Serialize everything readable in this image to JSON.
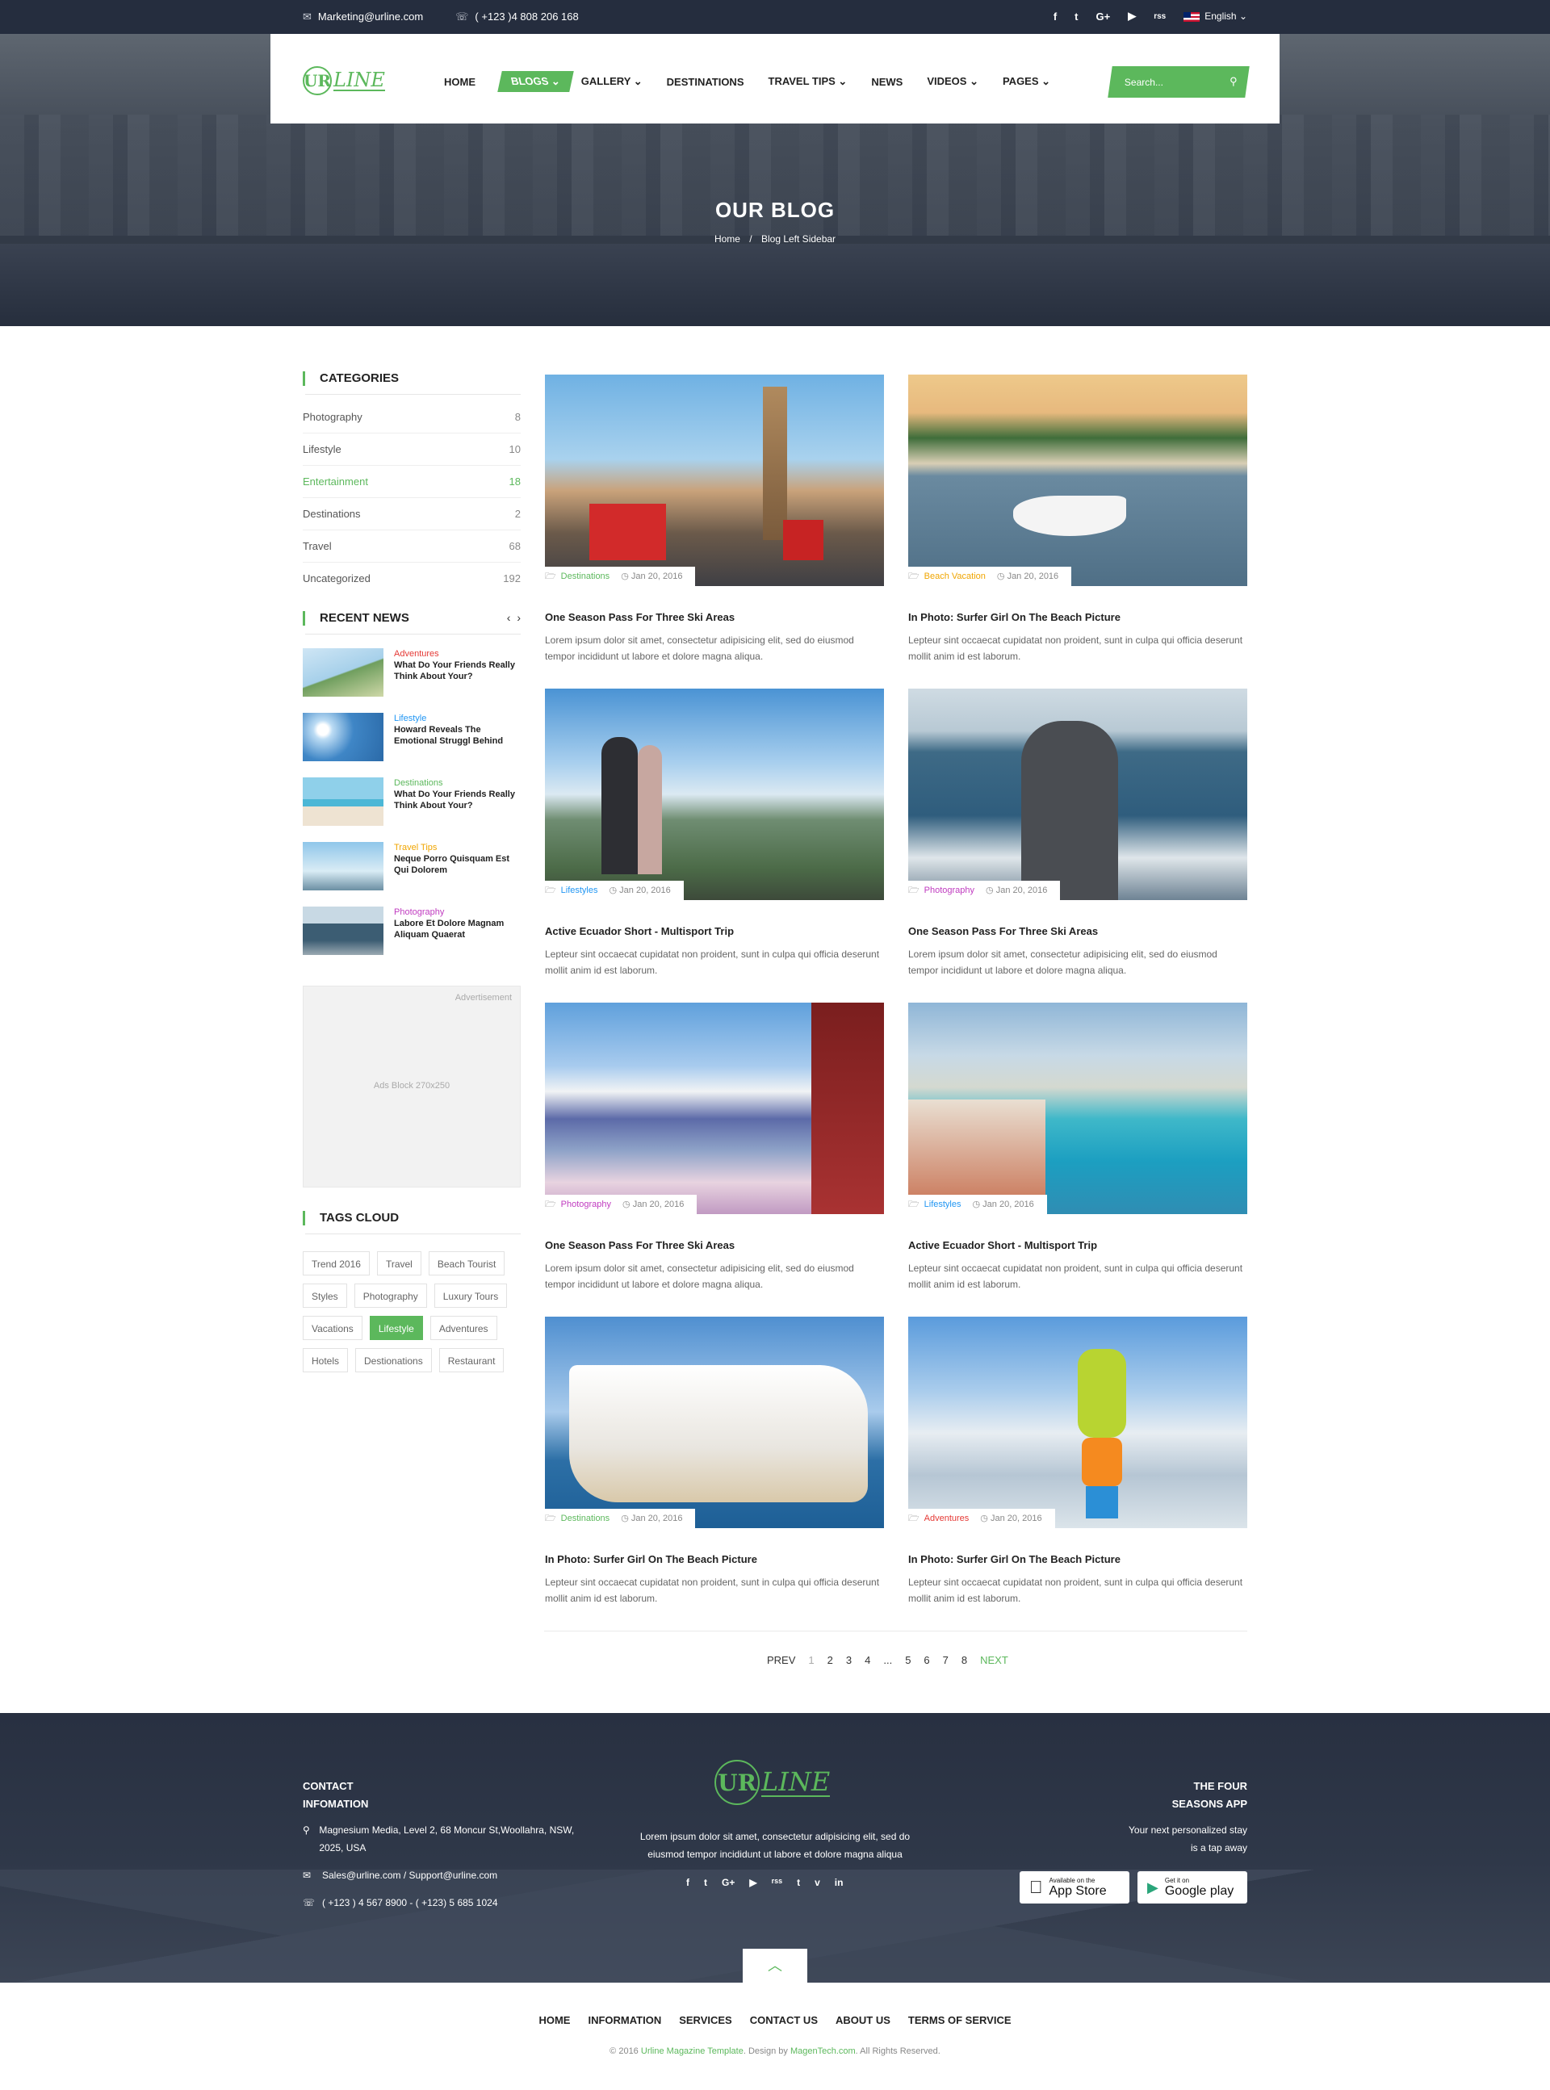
{
  "topbar": {
    "email": "Marketing@urline.com",
    "phone": "( +123 )4 808 206 168",
    "social": [
      "f",
      "t",
      "G+",
      "▶",
      "rss"
    ],
    "language": "English"
  },
  "brand": {
    "mark": "UR",
    "name": "LINE"
  },
  "menu": [
    {
      "label": "HOME",
      "dropdown": false
    },
    {
      "label": "BLOGS",
      "dropdown": true,
      "active": true
    },
    {
      "label": "GALLERY",
      "dropdown": true
    },
    {
      "label": "DESTINATIONS",
      "dropdown": false
    },
    {
      "label": "TRAVEL TIPS",
      "dropdown": true
    },
    {
      "label": "NEWS",
      "dropdown": false
    },
    {
      "label": "VIDEOS",
      "dropdown": true
    },
    {
      "label": "PAGES",
      "dropdown": true
    }
  ],
  "search": {
    "placeholder": "Search..."
  },
  "hero": {
    "title": "OUR BLOG",
    "crumb_home": "Home",
    "crumb_sep": "/",
    "crumb_current": "Blog Left Sidebar"
  },
  "sidebar": {
    "categories_title": "CATEGORIES",
    "categories": [
      {
        "name": "Photography",
        "count": "8"
      },
      {
        "name": "Lifestyle",
        "count": "10"
      },
      {
        "name": "Entertainment",
        "count": "18",
        "active": true
      },
      {
        "name": "Destinations",
        "count": "2"
      },
      {
        "name": "Travel",
        "count": "68"
      },
      {
        "name": "Uncategorized",
        "count": "192"
      }
    ],
    "recent_title": "RECENT NEWS",
    "recent": [
      {
        "cat": "Adventures",
        "color": "#e53935",
        "title": "What Do Your Friends Really Think About Your?"
      },
      {
        "cat": "Lifestyle",
        "color": "#2196f3",
        "title": "Howard Reveals The Emotional Struggl Behind"
      },
      {
        "cat": "Destinations",
        "color": "#5cb85c",
        "title": "What Do Your Friends Really Think About Your?"
      },
      {
        "cat": "Travel Tips",
        "color": "#f0a500",
        "title": "Neque Porro Quisquam Est Qui Dolorem"
      },
      {
        "cat": "Photography",
        "color": "#c03cc0",
        "title": "Labore Et Dolore Magnam Aliquam Quaerat"
      }
    ],
    "ad_label": "Advertisement",
    "ad_text": "Ads Block 270x250",
    "tags_title": "TAGS CLOUD",
    "tags": [
      {
        "name": "Trend 2016"
      },
      {
        "name": "Travel"
      },
      {
        "name": "Beach Tourist"
      },
      {
        "name": "Styles"
      },
      {
        "name": "Photography"
      },
      {
        "name": "Luxury Tours"
      },
      {
        "name": "Vacations"
      },
      {
        "name": "Lifestyle",
        "active": true
      },
      {
        "name": "Adventures"
      },
      {
        "name": "Hotels"
      },
      {
        "name": "Destionations"
      },
      {
        "name": "Restaurant"
      }
    ]
  },
  "posts": [
    {
      "cat": "Destinations",
      "color": "#5cb85c",
      "date": "Jan 20, 2016",
      "title": "One Season Pass For Three Ski Areas",
      "excerpt": "Lorem ipsum dolor sit amet, consectetur adipisicing elit, sed do eiusmod tempor incididunt ut labore et dolore magna aliqua.",
      "img": "london"
    },
    {
      "cat": "Beach Vacation",
      "color": "#f0a500",
      "date": "Jan 20, 2016",
      "title": "In Photo: Surfer Girl On The Beach Picture",
      "excerpt": "Lepteur sint occaecat cupidatat non proident, sunt in culpa qui officia deserunt mollit anim id est laborum.",
      "img": "boat"
    },
    {
      "cat": "Lifestyles",
      "color": "#2196f3",
      "date": "Jan 20, 2016",
      "title": "Active Ecuador Short - Multisport Trip",
      "excerpt": "Lepteur sint occaecat cupidatat non proident, sunt in culpa qui officia deserunt mollit anim id est laborum.",
      "img": "hikers"
    },
    {
      "cat": "Photography",
      "color": "#c03cc0",
      "date": "Jan 20, 2016",
      "title": "One Season Pass For Three Ski Areas",
      "excerpt": "Lorem ipsum dolor sit amet, consectetur adipisicing elit, sed do eiusmod tempor incididunt ut labore et dolore magna aliqua.",
      "img": "photographer"
    },
    {
      "cat": "Photography",
      "color": "#c03cc0",
      "date": "Jan 20, 2016",
      "title": "One Season Pass For Three Ski Areas",
      "excerpt": "Lorem ipsum dolor sit amet, consectetur adipisicing elit, sed do eiusmod tempor incididunt ut labore et dolore magna aliqua.",
      "img": "fuji"
    },
    {
      "cat": "Lifestyles",
      "color": "#2196f3",
      "date": "Jan 20, 2016",
      "title": "Active Ecuador Short - Multisport Trip",
      "excerpt": "Lepteur sint occaecat cupidatat non proident, sunt in culpa qui officia deserunt mollit anim id est laborum.",
      "img": "beach"
    },
    {
      "cat": "Destinations",
      "color": "#5cb85c",
      "date": "Jan 20, 2016",
      "title": "In Photo: Surfer Girl On The Beach Picture",
      "excerpt": "Lepteur sint occaecat cupidatat non proident, sunt in culpa qui officia deserunt mollit anim id est laborum.",
      "img": "ship"
    },
    {
      "cat": "Adventures",
      "color": "#e53935",
      "date": "Jan 20, 2016",
      "title": "In Photo: Surfer Girl On The Beach Picture",
      "excerpt": "Lepteur sint occaecat cupidatat non proident, sunt in culpa qui officia deserunt mollit anim id est laborum.",
      "img": "ski"
    }
  ],
  "pagination": {
    "prev": "PREV",
    "pages": [
      "1",
      "2",
      "3",
      "4",
      "...",
      "5",
      "6",
      "7",
      "8"
    ],
    "current": "1",
    "next": "NEXT"
  },
  "footer": {
    "contact_title": "CONTACT INFOMATION",
    "address": "Magnesium Media, Level 2, 68 Moncur St,Woollahra, NSW, 2025, USA",
    "email": "Sales@urline.com / Support@urline.com",
    "phone": "( +123 ) 4 567 8900 - ( +123) 5 685 1024",
    "about": "Lorem ipsum dolor sit amet, consectetur adipisicing elit, sed do eiusmod tempor incididunt ut labore et dolore magna aliqua",
    "social": [
      "f",
      "t",
      "G+",
      "▶",
      "rss",
      "t",
      "v",
      "in"
    ],
    "app_title": "THE FOUR SEASONS APP",
    "app_text": "Your next personalized stay is a tap away",
    "appstore_small": "Available on the",
    "appstore_big": "App Store",
    "gplay_small": "Get it on",
    "gplay_big": "Google play"
  },
  "bottomnav": [
    "HOME",
    "INFORMATION",
    "SERVICES",
    "CONTACT US",
    "ABOUT US",
    "TERMS OF SERVICE"
  ],
  "copyright": {
    "pre": "© 2016",
    "link1": "Urline Magazine Template",
    "mid": ". Design by",
    "link2": "MagenTech.com",
    "post": ". All Rights Reserved."
  }
}
